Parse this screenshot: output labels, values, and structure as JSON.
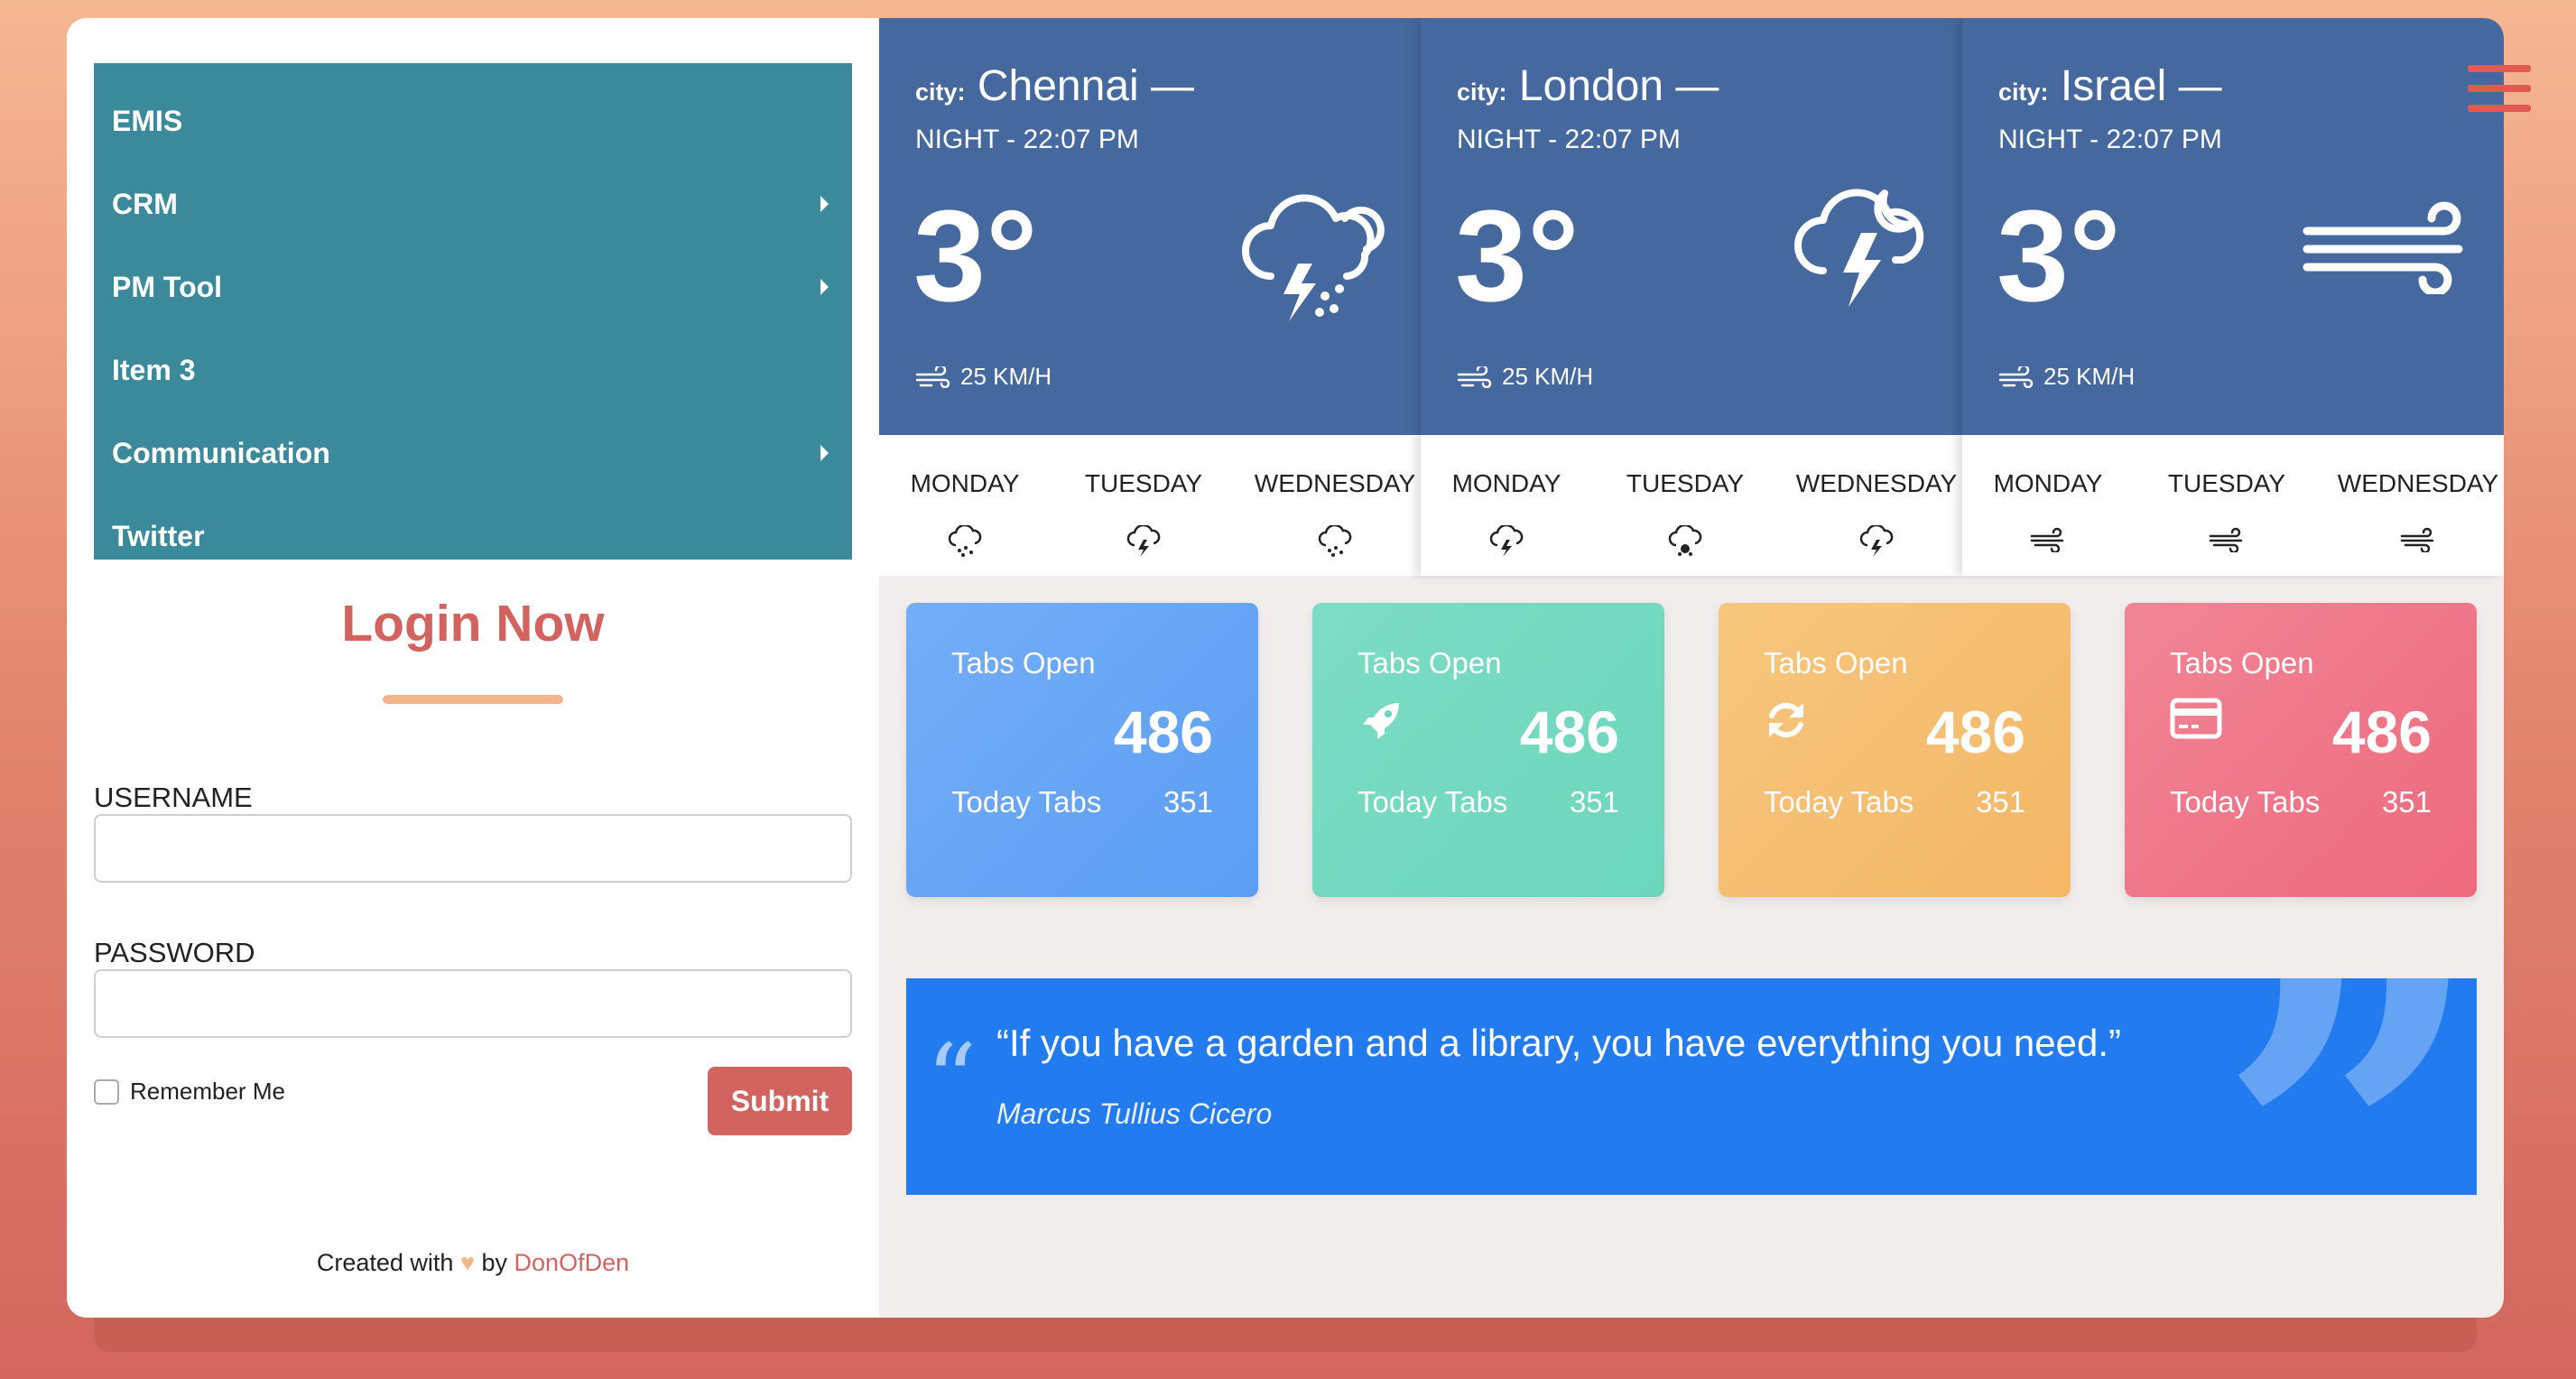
{
  "menu": {
    "items": [
      {
        "label": "EMIS",
        "has_submenu": false
      },
      {
        "label": "CRM",
        "has_submenu": true
      },
      {
        "label": "PM Tool",
        "has_submenu": true
      },
      {
        "label": "Item 3",
        "has_submenu": false
      },
      {
        "label": "Communication",
        "has_submenu": true
      },
      {
        "label": "Twitter",
        "has_submenu": false
      }
    ]
  },
  "login": {
    "title": "Login Now",
    "username_label": "USERNAME",
    "username_value": "",
    "password_label": "PASSWORD",
    "password_value": "",
    "remember_label": "Remember Me",
    "submit_label": "Submit"
  },
  "footer": {
    "prefix": "Created with",
    "heart": "♥",
    "by": "by",
    "link": "DonOfDen"
  },
  "weather": [
    {
      "city_label": "city:",
      "city": "Chennai",
      "dash": "—",
      "time": "NIGHT - 22:07 PM",
      "temp": "3°",
      "wind": "25 KM/H",
      "icon": "thunder-rain-icon",
      "days": [
        {
          "name": "MONDAY",
          "icon": "rain-icon"
        },
        {
          "name": "TUESDAY",
          "icon": "thunder-icon"
        },
        {
          "name": "WEDNESDAY",
          "icon": "rain-icon"
        }
      ]
    },
    {
      "city_label": "city:",
      "city": "London",
      "dash": "—",
      "time": "NIGHT - 22:07 PM",
      "temp": "3°",
      "wind": "25 KM/H",
      "icon": "thunder-night-icon",
      "days": [
        {
          "name": "MONDAY",
          "icon": "thunder-icon"
        },
        {
          "name": "TUESDAY",
          "icon": "hail-icon"
        },
        {
          "name": "WEDNESDAY",
          "icon": "thunder-icon"
        }
      ]
    },
    {
      "city_label": "city:",
      "city": "Israel",
      "dash": "—",
      "time": "NIGHT - 22:07 PM",
      "temp": "3°",
      "wind": "25 KM/H",
      "icon": "wind-icon",
      "days": [
        {
          "name": "MONDAY",
          "icon": "wind-icon"
        },
        {
          "name": "TUESDAY",
          "icon": "wind-icon"
        },
        {
          "name": "WEDNESDAY",
          "icon": "wind-icon"
        }
      ]
    }
  ],
  "stats": [
    {
      "title": "Tabs Open",
      "value": "486",
      "sub_label": "Today Tabs",
      "sub_value": "351",
      "icon": "",
      "color_from": "#74adf7",
      "color_to": "#5b9ef4"
    },
    {
      "title": "Tabs Open",
      "value": "486",
      "sub_label": "Today Tabs",
      "sub_value": "351",
      "icon": "rocket-icon",
      "color_from": "#7ddcc4",
      "color_to": "#6bd6bd"
    },
    {
      "title": "Tabs Open",
      "value": "486",
      "sub_label": "Today Tabs",
      "sub_value": "351",
      "icon": "refresh-icon",
      "color_from": "#f6c67e",
      "color_to": "#f4b766"
    },
    {
      "title": "Tabs Open",
      "value": "486",
      "sub_label": "Today Tabs",
      "sub_value": "351",
      "icon": "credit-card-icon",
      "color_from": "#f08595",
      "color_to": "#ee6a7d"
    }
  ],
  "quote": {
    "open_mark": "“",
    "text": "“If you have a garden and a library, you have everything you need.”",
    "author": "Marcus Tullius Cicero",
    "close_mark": "”"
  },
  "colors": {
    "menu_bg": "#3a8a9b",
    "accent": "#d2635f",
    "weather_bg": "#45699f",
    "quote_bg": "#237bf0"
  }
}
